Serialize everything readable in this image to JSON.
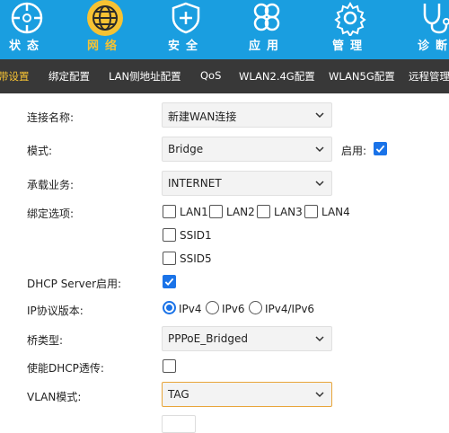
{
  "nav": {
    "items": [
      {
        "label": "状态",
        "icon": "compass-icon"
      },
      {
        "label": "网络",
        "icon": "globe-icon"
      },
      {
        "label": "安全",
        "icon": "shield-plus-icon"
      },
      {
        "label": "应用",
        "icon": "clover-icon"
      },
      {
        "label": "管理",
        "icon": "gear-icon"
      },
      {
        "label": "诊断",
        "icon": "stethoscope-icon"
      }
    ],
    "active_color": "#f6c233",
    "bar_color": "#1a9ee0"
  },
  "subnav": {
    "items": [
      "带设置",
      "绑定配置",
      "LAN侧地址配置",
      "QoS",
      "WLAN2.4G配置",
      "WLAN5G配置",
      "远程管理"
    ],
    "active_index": 0,
    "bar_color": "#383838"
  },
  "form": {
    "connection_name": {
      "label": "连接名称:",
      "value": "新建WAN连接"
    },
    "mode": {
      "label": "模式:",
      "value": "Bridge",
      "enable_label": "启用:",
      "enabled": true
    },
    "service": {
      "label": "承载业务:",
      "value": "INTERNET"
    },
    "binding": {
      "label": "绑定选项:",
      "options": [
        "LAN1",
        "LAN2",
        "LAN3",
        "LAN4",
        "SSID1",
        "SSID5"
      ]
    },
    "dhcp_server": {
      "label": "DHCP Server启用:",
      "checked": true
    },
    "ip_version": {
      "label": "IP协议版本:",
      "options": [
        "IPv4",
        "IPv6",
        "IPv4/IPv6"
      ],
      "selected": "IPv4"
    },
    "bridge_type": {
      "label": "桥类型:",
      "value": "PPPoE_Bridged"
    },
    "dhcp_passthrough": {
      "label": "使能DHCP透传:",
      "checked": false
    },
    "vlan_mode": {
      "label": "VLAN模式:",
      "value": "TAG"
    }
  }
}
